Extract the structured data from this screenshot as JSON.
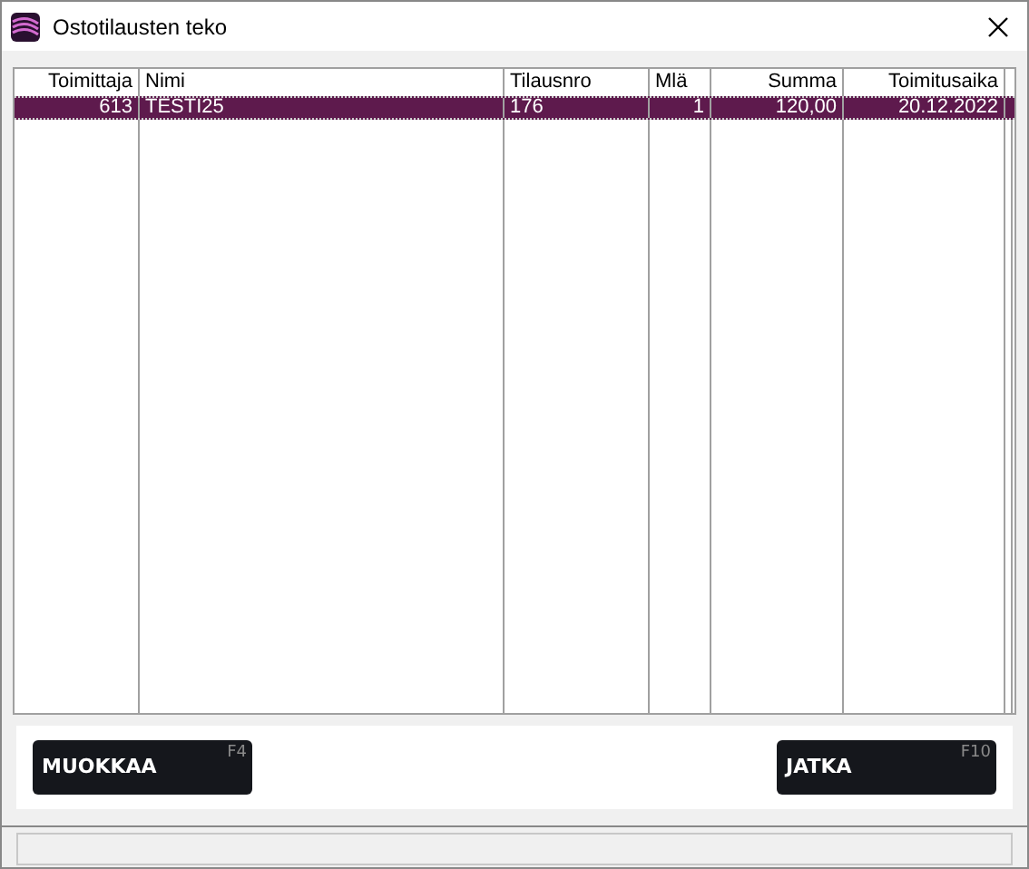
{
  "window": {
    "title": "Ostotilausten teko"
  },
  "table": {
    "columns": [
      "Toimittaja",
      "Nimi",
      "Tilausnro",
      "Mlä",
      "Summa",
      "Toimitusaika"
    ],
    "rows": [
      {
        "selected": true,
        "cells": [
          "613",
          "TESTI25",
          "176",
          "1",
          "120,00",
          "20.12.2022"
        ]
      }
    ]
  },
  "buttons": [
    {
      "label": "MUOKKAA",
      "shortcut": "F4"
    },
    {
      "label": "JATKA",
      "shortcut": "F10"
    }
  ]
}
